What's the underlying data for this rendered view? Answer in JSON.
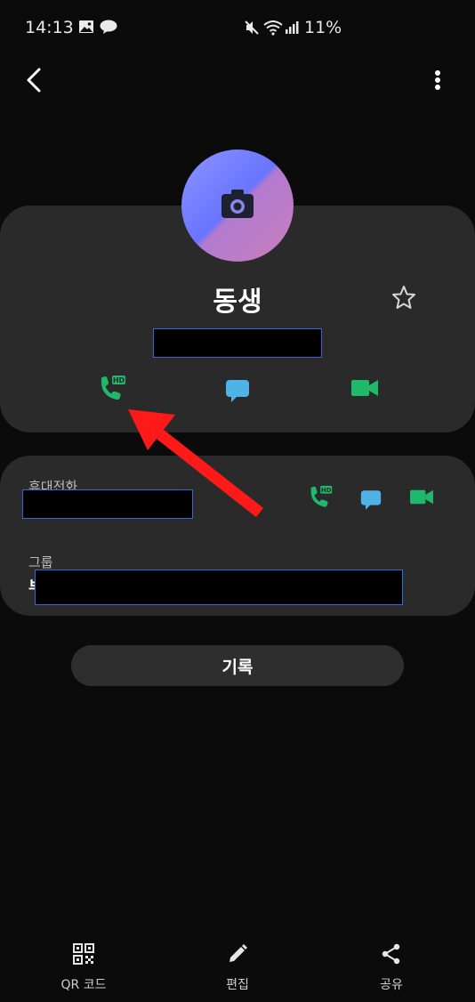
{
  "status_bar": {
    "time": "14:13",
    "battery": "11%"
  },
  "contact": {
    "name": "동생"
  },
  "details": {
    "phone_label": "휴대전화",
    "group_label": "그룹",
    "group_value_visible": "부"
  },
  "history": {
    "label": "기록"
  },
  "bottom_nav": {
    "qr": "QR 코드",
    "edit": "편집",
    "share": "공유"
  },
  "icons": {
    "back": "chevron-left-icon",
    "more": "more-vertical-icon",
    "camera": "camera-icon",
    "star": "star-outline-icon",
    "hd_call": "hd-call-icon",
    "message": "message-icon",
    "video": "video-call-icon",
    "qr": "qr-code-icon",
    "edit": "pencil-icon",
    "share": "share-icon"
  },
  "colors": {
    "call_green": "#1fb96b",
    "message_blue": "#4fb3e8",
    "arrow_red": "#ff1a1a",
    "redaction_border": "#2f6bd6"
  }
}
